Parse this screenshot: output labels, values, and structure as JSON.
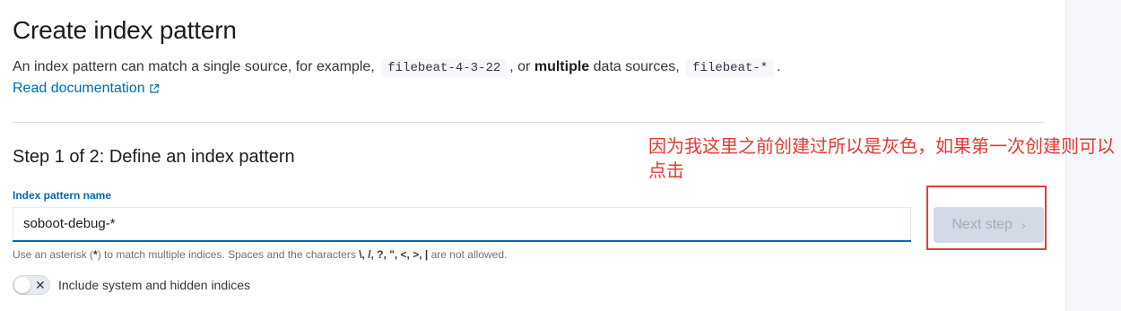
{
  "header": {
    "title": "Create index pattern",
    "intro_part1": "An index pattern can match a single source, for example,",
    "example_single": "filebeat-4-3-22",
    "intro_part2": ", or",
    "intro_bold": "multiple",
    "intro_part3": "data sources,",
    "example_multiple": "filebeat-*",
    "intro_end": ".",
    "doc_link": "Read documentation"
  },
  "step": {
    "title": "Step 1 of 2: Define an index pattern",
    "field_label": "Index pattern name",
    "field_value": "soboot-debug-*",
    "help_prefix": "Use an asterisk (",
    "help_asterisk": "*",
    "help_mid": ") to match multiple indices. Spaces and the characters",
    "help_chars": "\\, /, ?, \", <, >, |",
    "help_suffix": "are not allowed.",
    "toggle_label": "Include system and hidden indices",
    "toggle_on": false,
    "next_button": "Next step"
  },
  "annotation": {
    "text": "因为我这里之前创建过所以是灰色，如果第一次创建则可以点击",
    "color": "#e53935"
  },
  "colors": {
    "link": "#006bb4",
    "button_disabled_bg": "#d3dae6",
    "highlight_box": "#e53e3e"
  }
}
